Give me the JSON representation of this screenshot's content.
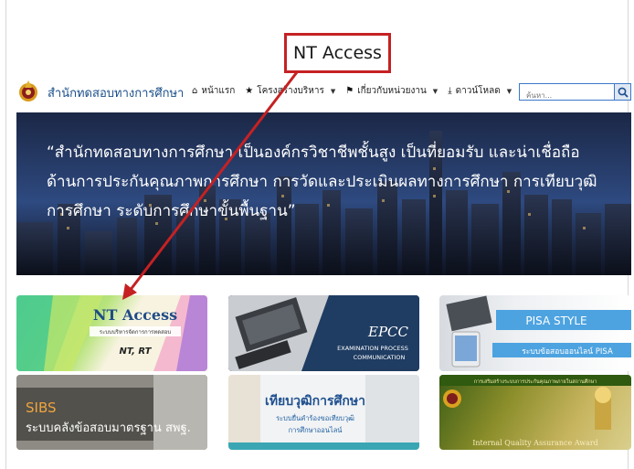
{
  "header": {
    "site_title": "สำนักทดสอบทางการศึกษา",
    "nav": [
      {
        "icon": "home-icon",
        "label": "หน้าแรก",
        "has_caret": false
      },
      {
        "icon": "star-icon",
        "label": "โครงสร้างบริหาร",
        "has_caret": true
      },
      {
        "icon": "flag-icon",
        "label": "เกี่ยวกับหน่วยงาน",
        "has_caret": true
      },
      {
        "icon": "download-icon",
        "label": "ดาวน์โหลด",
        "has_caret": true
      }
    ],
    "search_placeholder": "ค้นหา..."
  },
  "hero": {
    "line1": "“สำนักทดสอบทางการศึกษา เป็นองค์กรวิชาชีพชั้นสูง เป็นที่ยอมรับ และน่าเชื่อถือ",
    "line2": "ด้านการประกันคุณภาพการศึกษา การวัดและประเมินผลทางการศึกษา การเทียบวุฒิ",
    "line3": "การศึกษา ระดับการศึกษาขั้นพื้นฐาน”"
  },
  "callout": {
    "label": "NT Access",
    "color": "#c52123"
  },
  "tiles": {
    "nt_access": {
      "title": "NT Access",
      "subtitle": "ระบบบริหารจัดการการทดสอบ",
      "tag": "NT, RT"
    },
    "epcc": {
      "title": "EPCC",
      "line1": "EXAMINATION PROCESS",
      "line2": "COMMUNICATION"
    },
    "pisa": {
      "title": "PISA STYLE",
      "subtitle": "ระบบข้อสอบออนไลน์ PISA"
    },
    "sibs": {
      "title": "SIBS",
      "subtitle": "ระบบคลังข้อสอบมาตรฐาน สพฐ."
    },
    "equiv": {
      "title": "เทียบวุฒิการศึกษา",
      "line1": "ระบบยื่นคำร้องขอเทียบวุฒิ",
      "line2": "การศึกษาออนไลน์"
    },
    "iqa": {
      "top": "การเสริมสร้างระบบการประกันคุณภาพภายในสถานศึกษา",
      "award": "Internal Quality Assurance Award"
    }
  }
}
